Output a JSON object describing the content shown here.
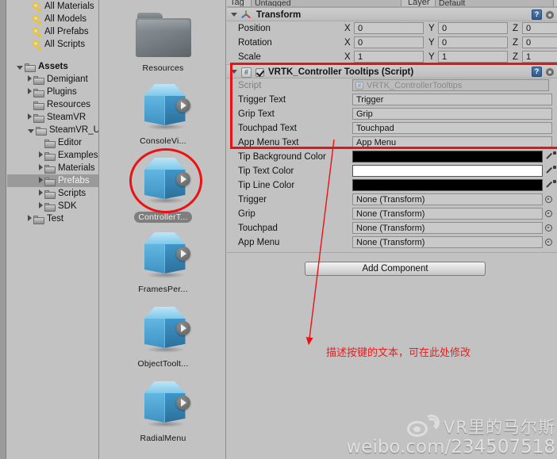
{
  "project_tree": {
    "searches": [
      {
        "label": "All Materials",
        "icon": "magnifier-icon"
      },
      {
        "label": "All Models",
        "icon": "magnifier-icon"
      },
      {
        "label": "All Prefabs",
        "icon": "magnifier-icon"
      },
      {
        "label": "All Scripts",
        "icon": "magnifier-icon"
      }
    ],
    "folders": [
      {
        "label": "Assets",
        "indent": 0,
        "twirl": "down",
        "bold": true,
        "selected": false
      },
      {
        "label": "Demigiant",
        "indent": 1,
        "twirl": "right",
        "bold": false,
        "selected": false
      },
      {
        "label": "Plugins",
        "indent": 1,
        "twirl": "right",
        "bold": false,
        "selected": false
      },
      {
        "label": "Resources",
        "indent": 1,
        "twirl": "none",
        "bold": false,
        "selected": false
      },
      {
        "label": "SteamVR",
        "indent": 1,
        "twirl": "right",
        "bold": false,
        "selected": false
      },
      {
        "label": "SteamVR_U",
        "indent": 1,
        "twirl": "down",
        "bold": false,
        "selected": false
      },
      {
        "label": "Editor",
        "indent": 2,
        "twirl": "none",
        "bold": false,
        "selected": false
      },
      {
        "label": "Examples",
        "indent": 2,
        "twirl": "right",
        "bold": false,
        "selected": false
      },
      {
        "label": "Materials",
        "indent": 2,
        "twirl": "right",
        "bold": false,
        "selected": false
      },
      {
        "label": "Prefabs",
        "indent": 2,
        "twirl": "right",
        "bold": false,
        "selected": true
      },
      {
        "label": "Scripts",
        "indent": 2,
        "twirl": "right",
        "bold": false,
        "selected": false
      },
      {
        "label": "SDK",
        "indent": 2,
        "twirl": "right",
        "bold": false,
        "selected": false
      },
      {
        "label": "Test",
        "indent": 1,
        "twirl": "right",
        "bold": false,
        "selected": false
      }
    ]
  },
  "assets": {
    "items": [
      {
        "name": "Resources",
        "kind": "folder",
        "selected": false,
        "highlighted": false
      },
      {
        "name": "ConsoleVi...",
        "kind": "prefab",
        "selected": false,
        "highlighted": false
      },
      {
        "name": "ControllerT...",
        "kind": "prefab",
        "selected": true,
        "highlighted": true
      },
      {
        "name": "FramesPer...",
        "kind": "prefab",
        "selected": false,
        "highlighted": false
      },
      {
        "name": "ObjectToolt...",
        "kind": "prefab",
        "selected": false,
        "highlighted": false
      },
      {
        "name": "RadialMenu",
        "kind": "prefab",
        "selected": false,
        "highlighted": false
      }
    ]
  },
  "inspector": {
    "tag_row": {
      "tag_label": "Tag",
      "tag_value": "Untagged",
      "layer_label": "Layer",
      "layer_value": "Default"
    },
    "transform": {
      "title": "Transform",
      "rows": [
        {
          "label": "Position",
          "x": "0",
          "y": "0",
          "z": "0"
        },
        {
          "label": "Rotation",
          "x": "0",
          "y": "0",
          "z": "0"
        },
        {
          "label": "Scale",
          "x": "1",
          "y": "1",
          "z": "1"
        }
      ],
      "axis_labels": {
        "x": "X",
        "y": "Y",
        "z": "Z"
      }
    },
    "script_component": {
      "title": "VRTK_Controller Tooltips (Script)",
      "enabled": true,
      "script_row": {
        "label": "Script",
        "value": "VRTK_ControllerTooltips"
      },
      "text_props": [
        {
          "label": "Trigger Text",
          "value": "Trigger"
        },
        {
          "label": "Grip Text",
          "value": "Grip"
        },
        {
          "label": "Touchpad Text",
          "value": "Touchpad"
        },
        {
          "label": "App Menu Text",
          "value": "App Menu"
        }
      ],
      "color_props": [
        {
          "label": "Tip Background Color",
          "swatch": "#000000"
        },
        {
          "label": "Tip Text Color",
          "swatch": "#ffffff"
        },
        {
          "label": "Tip Line Color",
          "swatch": "#000000"
        }
      ],
      "object_props": [
        {
          "label": "Trigger",
          "value": "None (Transform)"
        },
        {
          "label": "Grip",
          "value": "None (Transform)"
        },
        {
          "label": "Touchpad",
          "value": "None (Transform)"
        },
        {
          "label": "App Menu",
          "value": "None (Transform)"
        }
      ]
    },
    "add_component_label": "Add Component"
  },
  "annotations": {
    "note_text": "描述按键的文本，可在此处修改",
    "highlight_color": "#ee1111"
  },
  "watermark": {
    "account": "VR里的马尔斯",
    "url": "weibo.com/234507518",
    "logo": "weibo-eye-icon"
  }
}
